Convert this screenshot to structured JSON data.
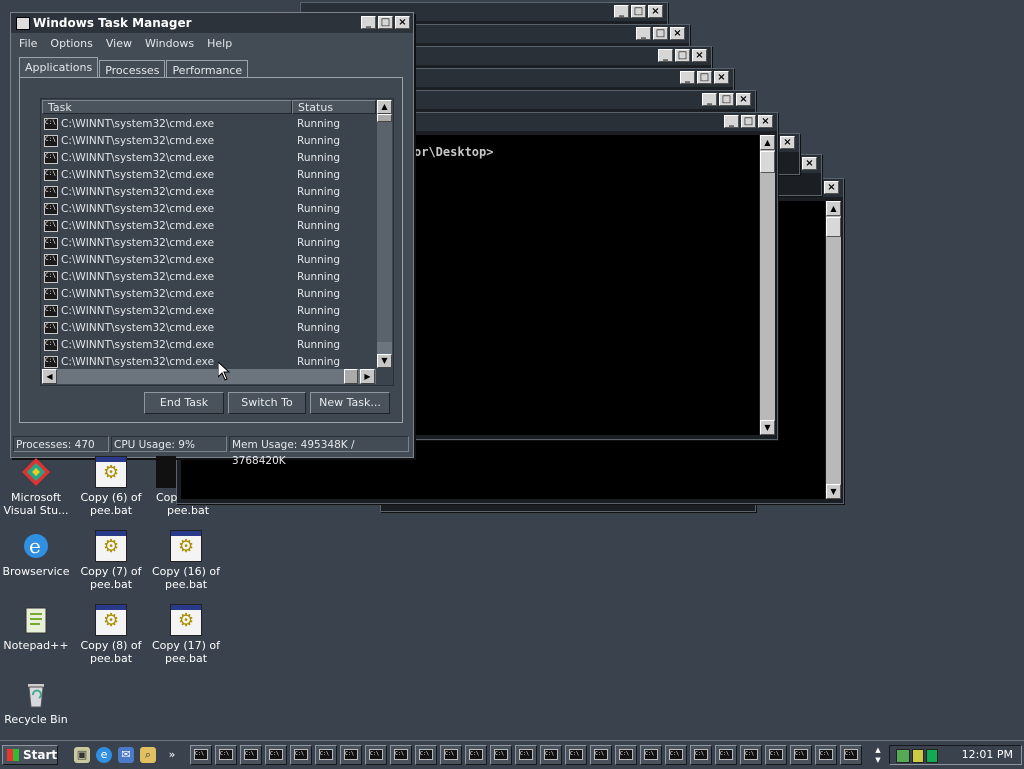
{
  "task_manager": {
    "title": "Windows Task Manager",
    "menu": [
      "File",
      "Options",
      "View",
      "Windows",
      "Help"
    ],
    "tabs": [
      "Applications",
      "Processes",
      "Performance"
    ],
    "active_tab": "Applications",
    "columns": {
      "task": "Task",
      "status": "Status"
    },
    "rows": [
      {
        "task": "C:\\WINNT\\system32\\cmd.exe",
        "status": "Running"
      },
      {
        "task": "C:\\WINNT\\system32\\cmd.exe",
        "status": "Running"
      },
      {
        "task": "C:\\WINNT\\system32\\cmd.exe",
        "status": "Running"
      },
      {
        "task": "C:\\WINNT\\system32\\cmd.exe",
        "status": "Running"
      },
      {
        "task": "C:\\WINNT\\system32\\cmd.exe",
        "status": "Running"
      },
      {
        "task": "C:\\WINNT\\system32\\cmd.exe",
        "status": "Running"
      },
      {
        "task": "C:\\WINNT\\system32\\cmd.exe",
        "status": "Running"
      },
      {
        "task": "C:\\WINNT\\system32\\cmd.exe",
        "status": "Running"
      },
      {
        "task": "C:\\WINNT\\system32\\cmd.exe",
        "status": "Running"
      },
      {
        "task": "C:\\WINNT\\system32\\cmd.exe",
        "status": "Running"
      },
      {
        "task": "C:\\WINNT\\system32\\cmd.exe",
        "status": "Running"
      },
      {
        "task": "C:\\WINNT\\system32\\cmd.exe",
        "status": "Running"
      },
      {
        "task": "C:\\WINNT\\system32\\cmd.exe",
        "status": "Running"
      },
      {
        "task": "C:\\WINNT\\system32\\cmd.exe",
        "status": "Running"
      },
      {
        "task": "C:\\WINNT\\system32\\cmd.exe",
        "status": "Running"
      }
    ],
    "buttons": {
      "end_task": "End Task",
      "switch_to": "Switch To",
      "new_task": "New Task..."
    },
    "status_bar": {
      "processes": "Processes: 470",
      "cpu": "CPU Usage: 9%",
      "mem": "Mem Usage: 495348K / 3768420K"
    }
  },
  "console": {
    "prompt_fragment": "or\\Desktop>"
  },
  "desktop_icons": [
    {
      "label": "Microsoft Visual Stu...",
      "icon": "visual-studio-icon"
    },
    {
      "label": "Copy (6) of pee.bat",
      "icon": "batch-file-icon"
    },
    {
      "label": "Cop",
      "label2": "pee.bat",
      "icon": "batch-file-icon"
    },
    {
      "label": "Browservice",
      "icon": "internet-explorer-icon"
    },
    {
      "label": "Copy (7) of pee.bat",
      "icon": "batch-file-icon"
    },
    {
      "label": "Copy (16) of pee.bat",
      "icon": "batch-file-icon"
    },
    {
      "label": "Notepad++",
      "icon": "notepad-plus-icon"
    },
    {
      "label": "Copy (8) of pee.bat",
      "icon": "batch-file-icon"
    },
    {
      "label": "Copy (17) of pee.bat",
      "icon": "batch-file-icon"
    },
    {
      "label": "Recycle Bin",
      "icon": "recycle-bin-icon"
    }
  ],
  "taskbar": {
    "start_label": "Start",
    "clock": "12:01 PM",
    "console_glyph": "C:\\"
  }
}
